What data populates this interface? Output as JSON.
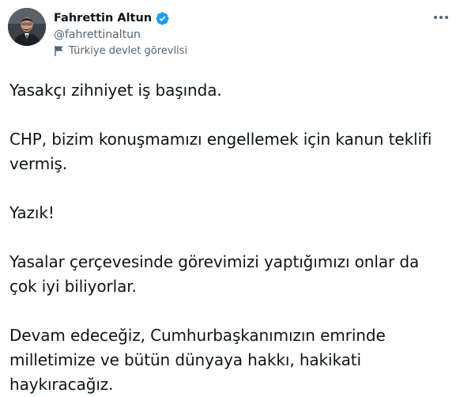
{
  "author": {
    "display_name": "Fahrettin Altun",
    "handle": "@fahrettinaltun",
    "label": "Türkiye devlet görevlisi",
    "verified": true,
    "verified_color": "#1d9bf0"
  },
  "icons": {
    "verified": "verified-badge-icon",
    "label": "flag-icon",
    "more": "more-dots-icon"
  },
  "tweet": {
    "paragraphs": [
      "Yasakçı zihniyet iş başında.",
      "CHP, bizim konuşmamızı engellemek için kanun teklifi\nvermiş.",
      "Yazık!",
      "Yasalar çerçevesinde görevimizi yaptığımızı onlar da\nçok iyi biliyorlar.",
      "Devam edeceğiz, Cumhurbaşkanımızın emrinde\nmilletimize ve bütün dünyaya hakkı, hakikati\nhaykıracağız."
    ]
  }
}
